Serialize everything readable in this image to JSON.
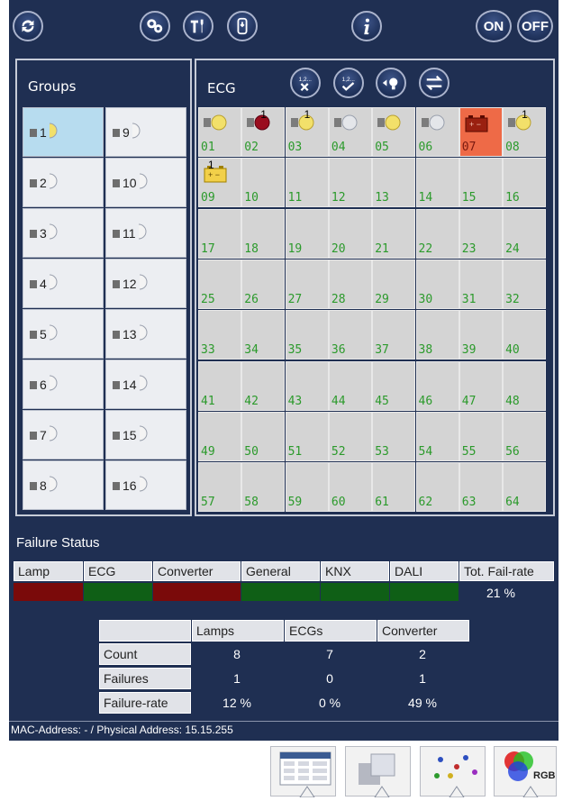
{
  "toolbar": {
    "on_label": "ON",
    "off_label": "OFF"
  },
  "groups": {
    "title": "Groups",
    "items": [
      "1",
      "2",
      "3",
      "4",
      "5",
      "6",
      "7",
      "8",
      "9",
      "10",
      "11",
      "12",
      "13",
      "14",
      "15",
      "16"
    ]
  },
  "ecg": {
    "title": "ECG",
    "cells": [
      {
        "n": "01",
        "type": "lamp-on"
      },
      {
        "n": "02",
        "type": "lamp-red",
        "sup": "1"
      },
      {
        "n": "03",
        "type": "lamp-on",
        "sup": "1"
      },
      {
        "n": "04",
        "type": "lamp-off"
      },
      {
        "n": "05",
        "type": "lamp-on"
      },
      {
        "n": "06",
        "type": "lamp-off"
      },
      {
        "n": "07",
        "type": "battery-red"
      },
      {
        "n": "08",
        "type": "lamp-on",
        "sup": "1"
      },
      {
        "n": "09",
        "type": "battery",
        "sup": "1"
      },
      {
        "n": "10"
      },
      {
        "n": "11"
      },
      {
        "n": "12"
      },
      {
        "n": "13"
      },
      {
        "n": "14"
      },
      {
        "n": "15"
      },
      {
        "n": "16"
      },
      {
        "n": "17"
      },
      {
        "n": "18"
      },
      {
        "n": "19"
      },
      {
        "n": "20"
      },
      {
        "n": "21"
      },
      {
        "n": "22"
      },
      {
        "n": "23"
      },
      {
        "n": "24"
      },
      {
        "n": "25"
      },
      {
        "n": "26"
      },
      {
        "n": "27"
      },
      {
        "n": "28"
      },
      {
        "n": "29"
      },
      {
        "n": "30"
      },
      {
        "n": "31"
      },
      {
        "n": "32"
      },
      {
        "n": "33"
      },
      {
        "n": "34"
      },
      {
        "n": "35"
      },
      {
        "n": "36"
      },
      {
        "n": "37"
      },
      {
        "n": "38"
      },
      {
        "n": "39"
      },
      {
        "n": "40"
      },
      {
        "n": "41"
      },
      {
        "n": "42"
      },
      {
        "n": "43"
      },
      {
        "n": "44"
      },
      {
        "n": "45"
      },
      {
        "n": "46"
      },
      {
        "n": "47"
      },
      {
        "n": "48"
      },
      {
        "n": "49"
      },
      {
        "n": "50"
      },
      {
        "n": "51"
      },
      {
        "n": "52"
      },
      {
        "n": "53"
      },
      {
        "n": "54"
      },
      {
        "n": "55"
      },
      {
        "n": "56"
      },
      {
        "n": "57"
      },
      {
        "n": "58"
      },
      {
        "n": "59"
      },
      {
        "n": "60"
      },
      {
        "n": "61"
      },
      {
        "n": "62"
      },
      {
        "n": "63"
      },
      {
        "n": "64"
      }
    ]
  },
  "failure": {
    "title": "Failure Status",
    "headers": [
      "Lamp",
      "ECG",
      "Converter",
      "General",
      "KNX",
      "DALI",
      "Tot. Fail-rate"
    ],
    "status_colors": [
      "#7a0a0a",
      "#0f5f16",
      "#7a0a0a",
      "#0f5f16",
      "#0f5f16",
      "#0f5f16"
    ],
    "total_rate": "21 %"
  },
  "stats": {
    "columns": [
      "Lamps",
      "ECGs",
      "Converter"
    ],
    "rows": [
      {
        "label": "Count",
        "values": [
          "8",
          "7",
          "2"
        ]
      },
      {
        "label": "Failures",
        "values": [
          "1",
          "0",
          "1"
        ]
      },
      {
        "label": "Failure-rate",
        "values": [
          "12 %",
          "0 %",
          "49 %"
        ]
      }
    ]
  },
  "footer": {
    "address": "MAC-Address: - / Physical Address: 15.15.255"
  },
  "bottom": {
    "rgb_label": "RGB"
  },
  "icons": {
    "ecg_buttons": [
      "1,2...",
      "1,2..."
    ]
  },
  "colors": {
    "background": "#1f2f52",
    "lamp_on": "#f2e06a",
    "lamp_red": "#9a0d1e",
    "cell_red": "#ee6a47",
    "number_green": "#2b9a2b"
  }
}
